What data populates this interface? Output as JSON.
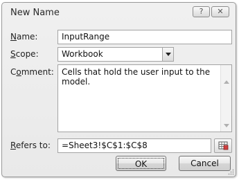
{
  "dialog": {
    "title": "New Name",
    "help_glyph": "?",
    "close_glyph": "✕"
  },
  "form": {
    "name": {
      "label_mnemonic": "N",
      "label_rest": "ame:",
      "value": "InputRange"
    },
    "scope": {
      "label_mnemonic": "S",
      "label_rest": "cope:",
      "value": "Workbook"
    },
    "comment": {
      "label_pre": "C",
      "label_mnemonic": "o",
      "label_rest": "mment:",
      "value": "Cells that hold the user input to the model."
    },
    "refers_to": {
      "label_mnemonic": "R",
      "label_rest": "efers to:",
      "value": "=Sheet3!$C$1:$C$8"
    }
  },
  "buttons": {
    "ok": "OK",
    "cancel": "Cancel"
  },
  "icons": {
    "help": "help-icon",
    "close": "close-icon",
    "dropdown": "chevron-down-icon",
    "collapse": "range-select-icon",
    "scroll_up": "scroll-up-icon",
    "scroll_down": "scroll-down-icon",
    "resize": "resize-grip-icon"
  }
}
